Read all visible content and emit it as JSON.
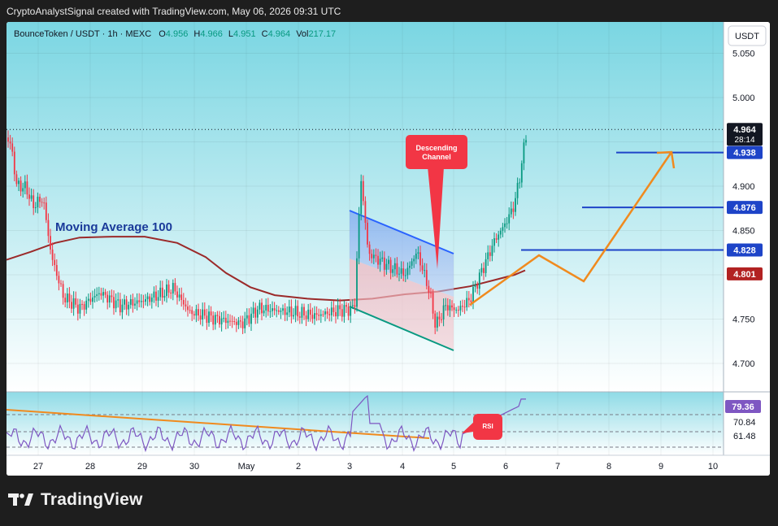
{
  "header": {
    "caption": "CryptoAnalystSignal created with TradingView.com, May 06, 2026 09:31 UTC"
  },
  "footer": {
    "brand": "TradingView"
  },
  "chart_data": {
    "type": "candlestick",
    "symbol": {
      "name": "BounceToken / USDT · 1h · MEXC",
      "open_label": "O",
      "open": "4.956",
      "high_label": "H",
      "high": "4.966",
      "low_label": "L",
      "low": "4.951",
      "close_label": "C",
      "close": "4.964",
      "vol_label": "Vol",
      "vol": "217.17"
    },
    "currency_button": "USDT",
    "ylim": [
      4.68,
      5.06
    ],
    "y_ticks": [
      "4.700",
      "4.750",
      "4.800",
      "4.850",
      "4.900",
      "4.950",
      "5.000",
      "5.050"
    ],
    "x_ticks": [
      "27",
      "28",
      "29",
      "30",
      "May",
      "2",
      "3",
      "4",
      "5",
      "6",
      "7",
      "8",
      "9",
      "10"
    ],
    "price_labels": [
      {
        "text": "4.964",
        "value": 4.964,
        "color": "#131722",
        "countdown": "28:14"
      },
      {
        "text": "4.938",
        "value": 4.938,
        "color": "#1e44c8"
      },
      {
        "text": "4.876",
        "value": 4.876,
        "color": "#1e44c8"
      },
      {
        "text": "4.828",
        "value": 4.828,
        "color": "#1e44c8"
      },
      {
        "text": "4.801",
        "value": 4.801,
        "color": "#b22222"
      }
    ],
    "annotations": {
      "ma_label": "Moving Average 100",
      "channel_label_line1": "Descending",
      "channel_label_line2": "Channel",
      "rsi_label": "RSI"
    },
    "rsi": {
      "values_labels": [
        "79.36",
        "70.84",
        "61.48"
      ],
      "last": 79.36
    },
    "colors": {
      "up": "#089981",
      "down": "#f23645",
      "ma": "#9b2a2a",
      "levels": "#1e44c8",
      "projection": "#f08a1e",
      "rsi": "#7e57c2",
      "bg_top": "#7fd9e3",
      "bg_bottom": "#ffffff"
    }
  }
}
